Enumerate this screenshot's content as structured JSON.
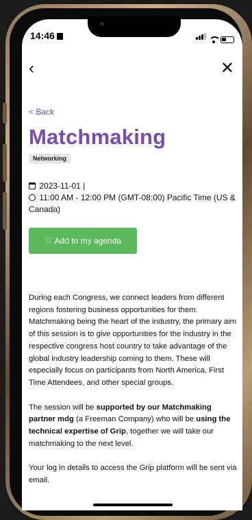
{
  "status": {
    "time": "14:46"
  },
  "nav": {
    "back_symbol": "‹",
    "close_symbol": "✕"
  },
  "page": {
    "back_label": "< Back",
    "title": "Matchmaking",
    "tag": "Networking",
    "date": "2023-11-01 |",
    "time_range": "11:00 AM - 12:00 PM (GMT-08:00) Pacific Time (US & Canada)",
    "agenda_button": "Add to my agenda",
    "accent_color": "#7a4bab",
    "button_color": "#5cb85c"
  },
  "description": {
    "p1": "During each Congress, we connect leaders from different regions fostering business opportunities for them. Matchmaking being the heart of the industry, the primary aim of this session is to give opportunities for the industry in the respective congress host country to take advantage of the global industry leadership coming to them. These will especially focus on participants from North America, First Time Attendees, and other special groups.",
    "p2_a": "The session will be ",
    "p2_b": "supported by our Matchmaking partner mdg",
    "p2_c": " (a Freeman Company) who will be ",
    "p2_d": "using the technical expertise of Grip",
    "p2_e": ", together we will take our matchmaking to the next level.",
    "p3": "Your log in details to access the Grip platform will be sent via email."
  }
}
